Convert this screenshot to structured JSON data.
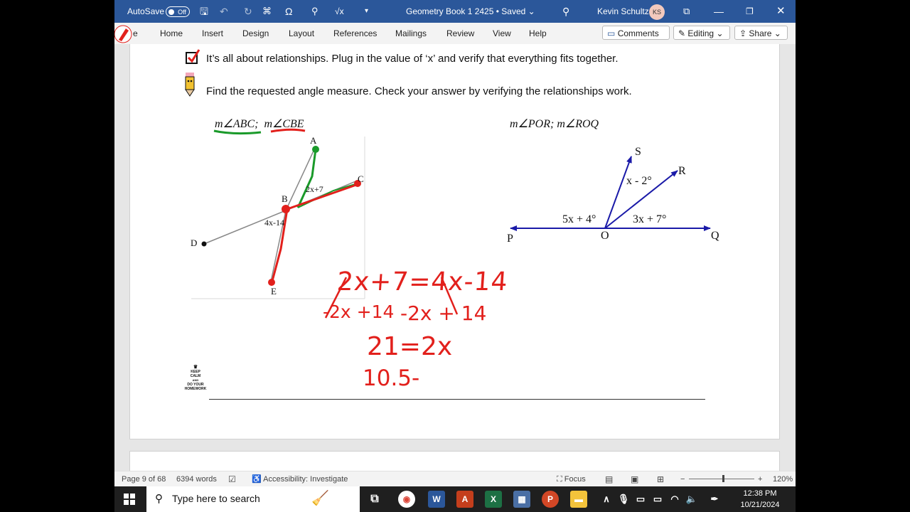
{
  "titlebar": {
    "autosave_label": "AutoSave",
    "autosave_state": "Off",
    "doc_title": "Geometry Book 1 2425",
    "save_status": "Saved",
    "user_name": "Kevin Schultz",
    "user_initials": "KS"
  },
  "ribbon": {
    "tabs": [
      "e",
      "Home",
      "Insert",
      "Design",
      "Layout",
      "References",
      "Mailings",
      "Review",
      "View",
      "Help"
    ],
    "comments": "Comments",
    "editing": "Editing",
    "share": "Share"
  },
  "document": {
    "instruction1": "It’s all about relationships.  Plug in the value of ‘x’ and verify that everything fits together.",
    "instruction2": "Find the requested angle measure.  Check your answer by verifying the relationships work.",
    "problem1": {
      "prompt_part1": "m∠ABC;",
      "prompt_part2": "m∠CBE",
      "points": {
        "A": "A",
        "B": "B",
        "C": "C",
        "D": "D",
        "E": "E"
      },
      "angle_label1": "2x+7",
      "angle_label2": "4x-14"
    },
    "problem2": {
      "prompt": "m∠POR;  m∠ROQ",
      "points": {
        "S": "S",
        "R": "R",
        "P": "P",
        "O": "O",
        "Q": "Q"
      },
      "angle_label1": "x - 2°",
      "angle_label2": "5x + 4°",
      "angle_label3": "3x + 7°"
    },
    "handwriting": {
      "line1": "2x+7=4x-14",
      "line2a": "-2x +14",
      "line2b": "-2x + 14",
      "line3": "21=2x",
      "line4": "10.5-"
    },
    "keep_calm": [
      "KEEP",
      "CALM",
      "AND",
      "DO YOUR",
      "HOMEWORK"
    ]
  },
  "statusbar": {
    "page": "Page 9 of 68",
    "words": "6394 words",
    "accessibility": "Accessibility: Investigate",
    "focus": "Focus",
    "zoom": "120%"
  },
  "taskbar": {
    "search_placeholder": "Type here to search",
    "time": "12:38 PM",
    "date": "10/21/2024"
  },
  "colors": {
    "word_blue": "#2b579a",
    "ink_red": "#e2201c",
    "ink_green": "#1a9a2a",
    "diagram_blue": "#1a1aa8"
  }
}
